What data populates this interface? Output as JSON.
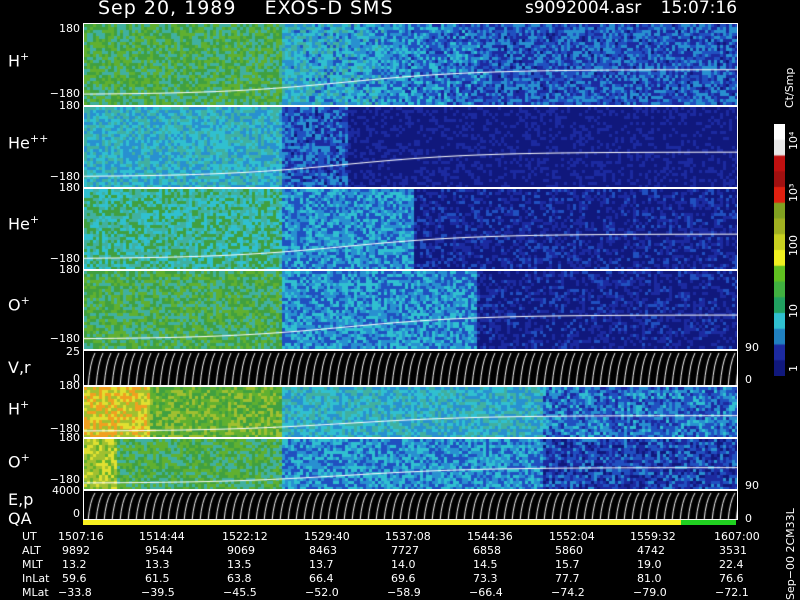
{
  "header": {
    "date": "Sep 20, 1989",
    "instrument": "EXOS-D SMS",
    "filename": "s9092004.asr",
    "time": "15:07:16"
  },
  "panels": [
    {
      "label": "H",
      "charge": "+",
      "top_tick": "180",
      "bottom_tick": "−180"
    },
    {
      "label": "He",
      "charge": "++",
      "top_tick": "180",
      "bottom_tick": "−180"
    },
    {
      "label": "He",
      "charge": "+",
      "top_tick": "180",
      "bottom_tick": "−180"
    },
    {
      "label": "O",
      "charge": "+",
      "top_tick": "180",
      "bottom_tick": "−180"
    },
    {
      "label": "V,r",
      "charge": "",
      "top_tick": "25",
      "bottom_tick": "0",
      "right_top": "90",
      "right_bottom": "0"
    },
    {
      "label": "H",
      "charge": "+",
      "top_tick": "180",
      "bottom_tick": "−180"
    },
    {
      "label": "O",
      "charge": "+",
      "top_tick": "180",
      "bottom_tick": "−180"
    },
    {
      "label": "E,p",
      "charge": "",
      "top_tick": "4000",
      "bottom_tick": "0",
      "right_top": "90",
      "right_bottom": "0"
    }
  ],
  "qa_label": "QA",
  "colorbar": {
    "unit": "Ct/Smp",
    "ticks": [
      "10⁴",
      "10³",
      "100",
      "10",
      "1"
    ]
  },
  "time_axis": {
    "rows": [
      {
        "name": "UT",
        "values": [
          "1507:16",
          "1514:44",
          "1522:12",
          "1529:40",
          "1537:08",
          "1544:36",
          "1552:04",
          "1559:32",
          "1607:00"
        ]
      },
      {
        "name": "ALT",
        "values": [
          "9892",
          "9544",
          "9069",
          "8463",
          "7727",
          "6858",
          "5860",
          "4742",
          "3531"
        ]
      },
      {
        "name": "MLT",
        "values": [
          "13.2",
          "13.3",
          "13.5",
          "13.7",
          "14.0",
          "14.5",
          "15.7",
          "19.0",
          "22.4"
        ]
      },
      {
        "name": "InLat",
        "values": [
          "59.6",
          "61.5",
          "63.8",
          "66.4",
          "69.6",
          "73.3",
          "77.7",
          "81.0",
          "76.6"
        ]
      },
      {
        "name": "MLat",
        "values": [
          "−33.8",
          "−39.5",
          "−45.5",
          "−52.0",
          "−58.9",
          "−66.4",
          "−74.2",
          "−79.0",
          "−72.1"
        ]
      }
    ]
  },
  "stamp": "Sep−00  2CM33L",
  "colors": {
    "background": "#000000",
    "deep_blue": "#101890",
    "cyan": "#30c0d0",
    "green": "#40b040",
    "yellow": "#f8f020",
    "qa_green": "#20d020"
  }
}
